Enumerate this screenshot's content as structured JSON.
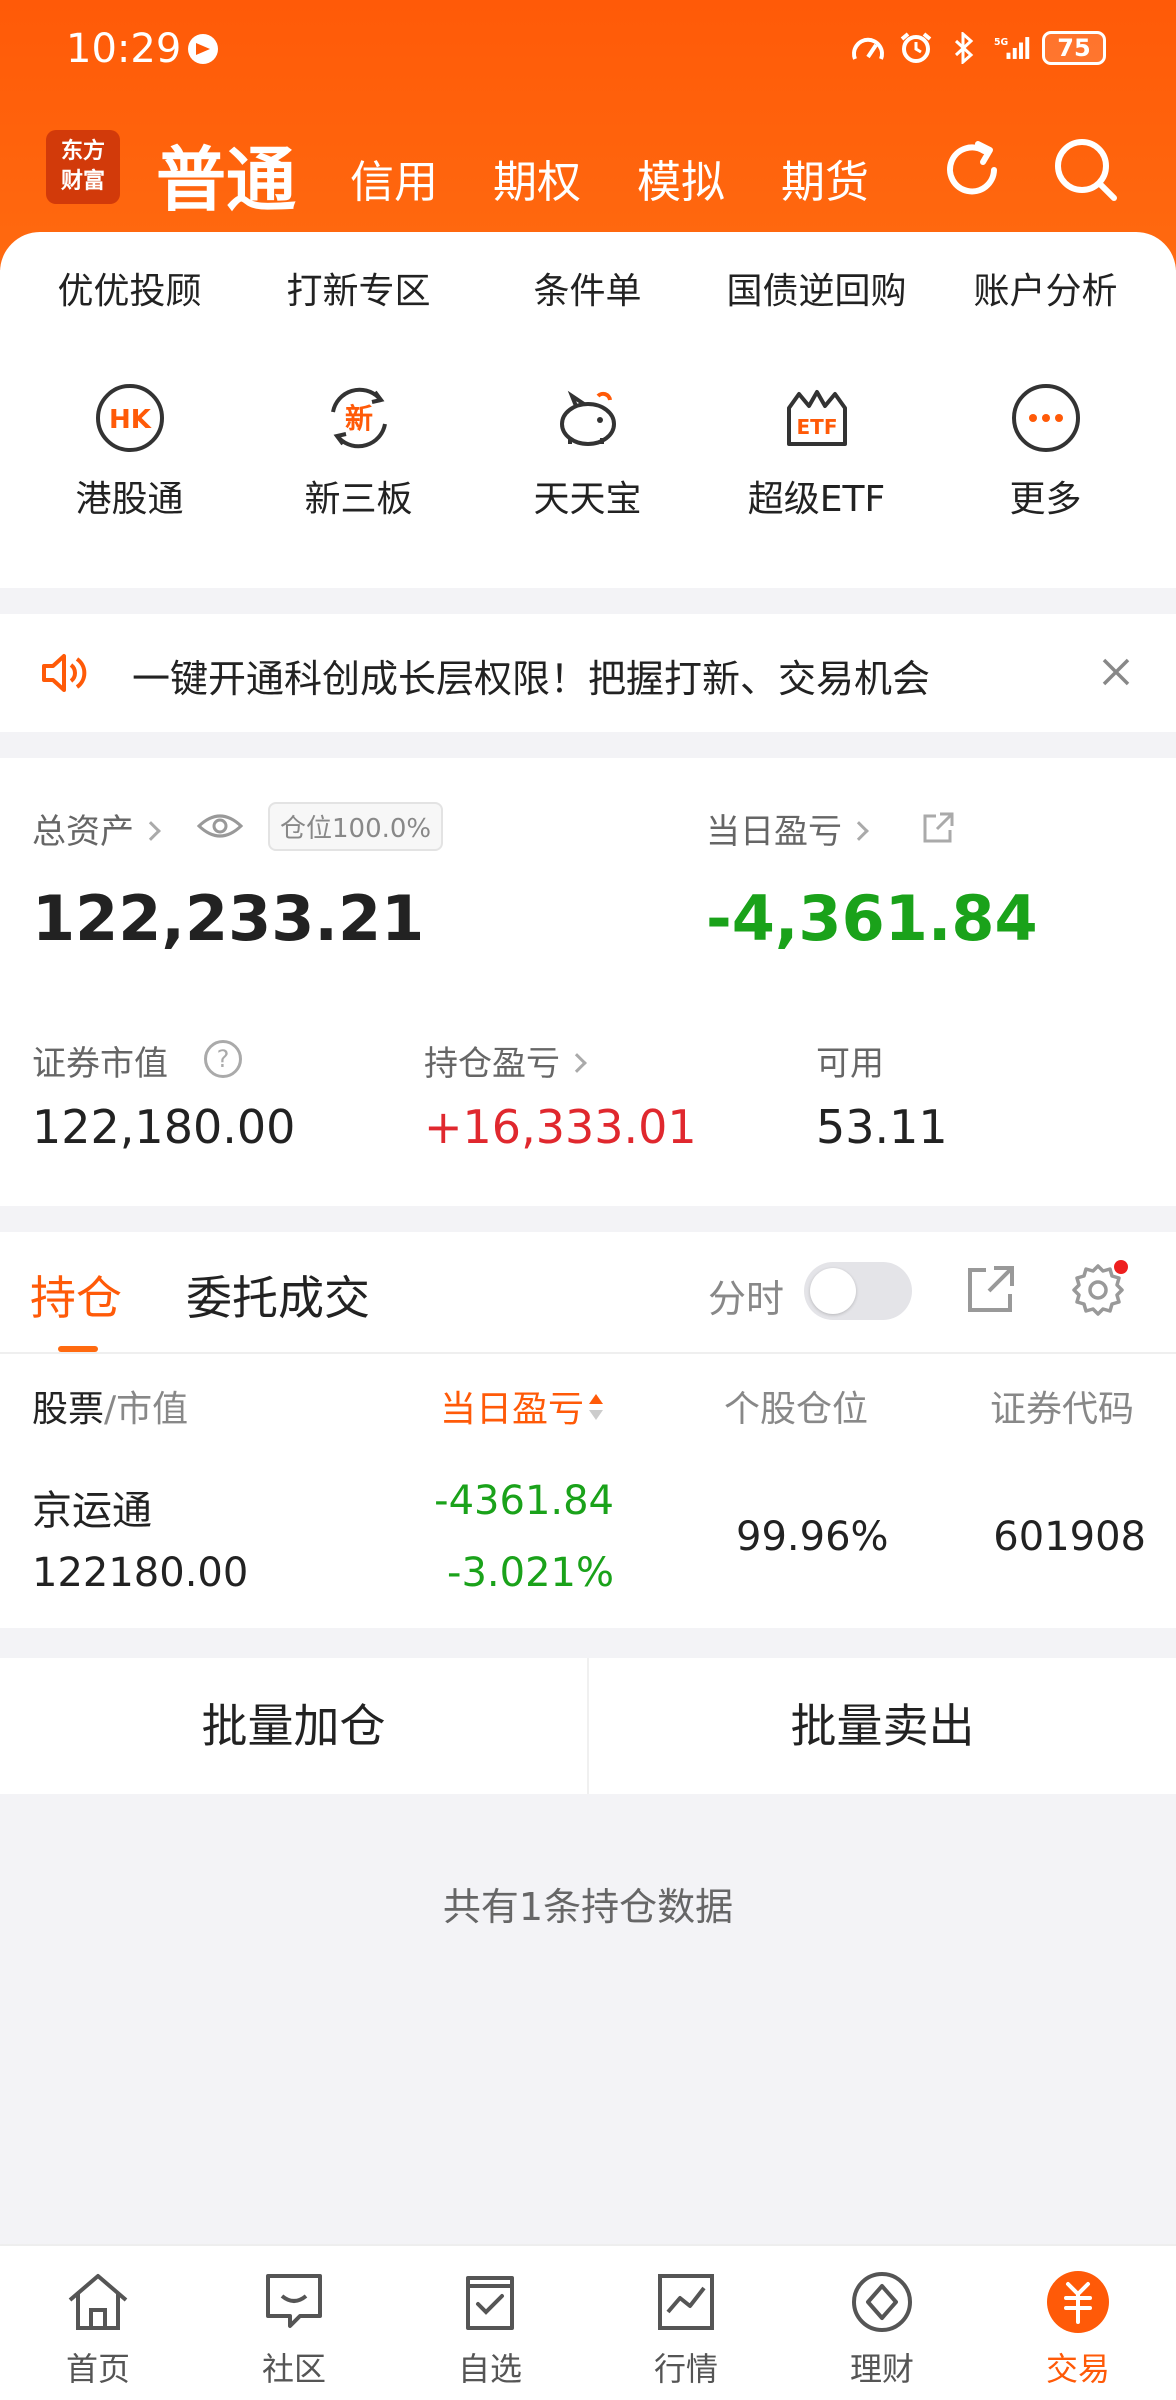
{
  "status_bar": {
    "time": "10:29",
    "network": "5G",
    "battery": "75"
  },
  "header": {
    "logo_line1": "东方",
    "logo_line2": "财富",
    "tabs": [
      {
        "label": "普通",
        "active": true
      },
      {
        "label": "信用"
      },
      {
        "label": "期权"
      },
      {
        "label": "模拟"
      },
      {
        "label": "期货"
      }
    ]
  },
  "grid_row1": [
    "优优投顾",
    "打新专区",
    "条件单",
    "国债逆回购",
    "账户分析"
  ],
  "grid_row2": [
    {
      "label": "港股通",
      "icon": "hk-icon",
      "icon_text": "HK"
    },
    {
      "label": "新三板",
      "icon": "xin-icon",
      "icon_text": "新"
    },
    {
      "label": "天天宝",
      "icon": "piggy-bank-icon"
    },
    {
      "label": "超级ETF",
      "icon": "etf-icon",
      "icon_text": "ETF"
    },
    {
      "label": "更多",
      "icon": "more-icon"
    }
  ],
  "banner": {
    "text": "一键开通科创成长层权限！把握打新、交易机会"
  },
  "assets": {
    "total_label": "总资产",
    "position_badge": "仓位100.0%",
    "total_value": "122,233.21",
    "daily_pnl_label": "当日盈亏",
    "daily_pnl_value": "-4,361.84",
    "market_value_label": "证券市值",
    "market_value": "122,180.00",
    "holding_pnl_label": "持仓盈亏",
    "holding_pnl": "+16,333.01",
    "available_label": "可用",
    "available": "53.11"
  },
  "holdings": {
    "tab_active": "持仓",
    "tab_other": "委托成交",
    "fenshi_label": "分时",
    "columns": {
      "stock": "股票",
      "market_value": "/市值",
      "daily_pnl": "当日盈亏",
      "position": "个股仓位",
      "code": "证券代码"
    },
    "rows": [
      {
        "name": "京运通",
        "market_value": "122180.00",
        "pnl": "-4361.84",
        "pnl_pct": "-3.021%",
        "position": "99.96%",
        "code": "601908"
      }
    ]
  },
  "actions": {
    "add": "批量加仓",
    "sell": "批量卖出"
  },
  "footer_note": "共有1条持仓数据",
  "bottom_nav": [
    {
      "label": "首页",
      "icon": "home-icon"
    },
    {
      "label": "社区",
      "icon": "chat-icon"
    },
    {
      "label": "自选",
      "icon": "watchlist-icon"
    },
    {
      "label": "行情",
      "icon": "market-chart-icon"
    },
    {
      "label": "理财",
      "icon": "wealth-icon"
    },
    {
      "label": "交易",
      "icon": "trade-icon",
      "active": true
    }
  ],
  "colors": {
    "brand": "#ff5a08",
    "up": "#e0282e",
    "down": "#1aa21a"
  }
}
